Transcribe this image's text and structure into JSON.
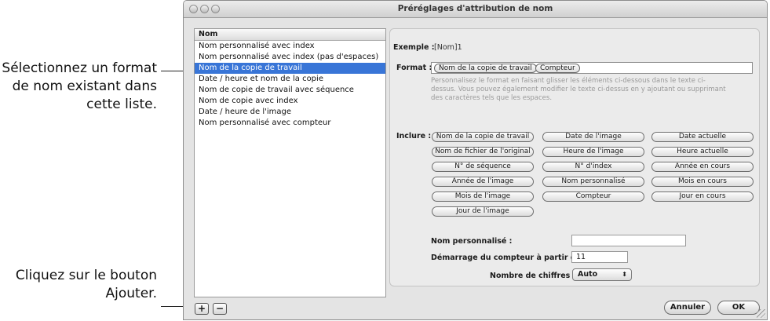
{
  "window": {
    "title": "Préréglages d'attribution de nom"
  },
  "callouts": [
    "Sélectionnez un format de nom existant dans cette liste.",
    "Cliquez sur le bouton Ajouter."
  ],
  "list": {
    "header": "Nom",
    "items": [
      "Nom personnalisé avec index",
      "Nom personnalisé avec index (pas d'espaces)",
      "Nom de la copie de travail",
      "Date / heure et nom de la copie",
      "Nom de copie de travail avec séquence",
      "Nom de copie avec index",
      "Date / heure de l'image",
      "Nom personnalisé avec compteur"
    ],
    "selected_index": 2
  },
  "example": {
    "label": "Exemple :",
    "value": "[Nom]1"
  },
  "format": {
    "label": "Format :",
    "tokens": [
      "Nom de la copie de travail",
      "Compteur"
    ],
    "help": "Personnalisez le format en faisant glisser les éléments ci-dessous dans le texte ci-dessus. Vous pouvez également modifier le texte ci-dessus en y ajoutant ou supprimant des caractères tels que les espaces."
  },
  "include": {
    "label": "Inclure :",
    "items": [
      "Nom de la copie de travail",
      "Date de l'image",
      "Date actuelle",
      "Nom de fichier de l'original",
      "Heure de l'image",
      "Heure actuelle",
      "N° de séquence",
      "N° d'index",
      "Année en cours",
      "Année de l'image",
      "Nom personnalisé",
      "Mois en cours",
      "Mois de l'image",
      "Compteur",
      "Jour en cours",
      "Jour de l'image"
    ]
  },
  "custom_name": {
    "label": "Nom personnalisé :",
    "value": ""
  },
  "counter_start": {
    "label": "Démarrage du compteur à partir de :",
    "value": "11"
  },
  "digits": {
    "label": "Nombre de chiffres :",
    "value": "Auto",
    "arrows": "⬍"
  },
  "buttons": {
    "add": "+",
    "remove": "−",
    "cancel": "Annuler",
    "ok": "OK"
  }
}
